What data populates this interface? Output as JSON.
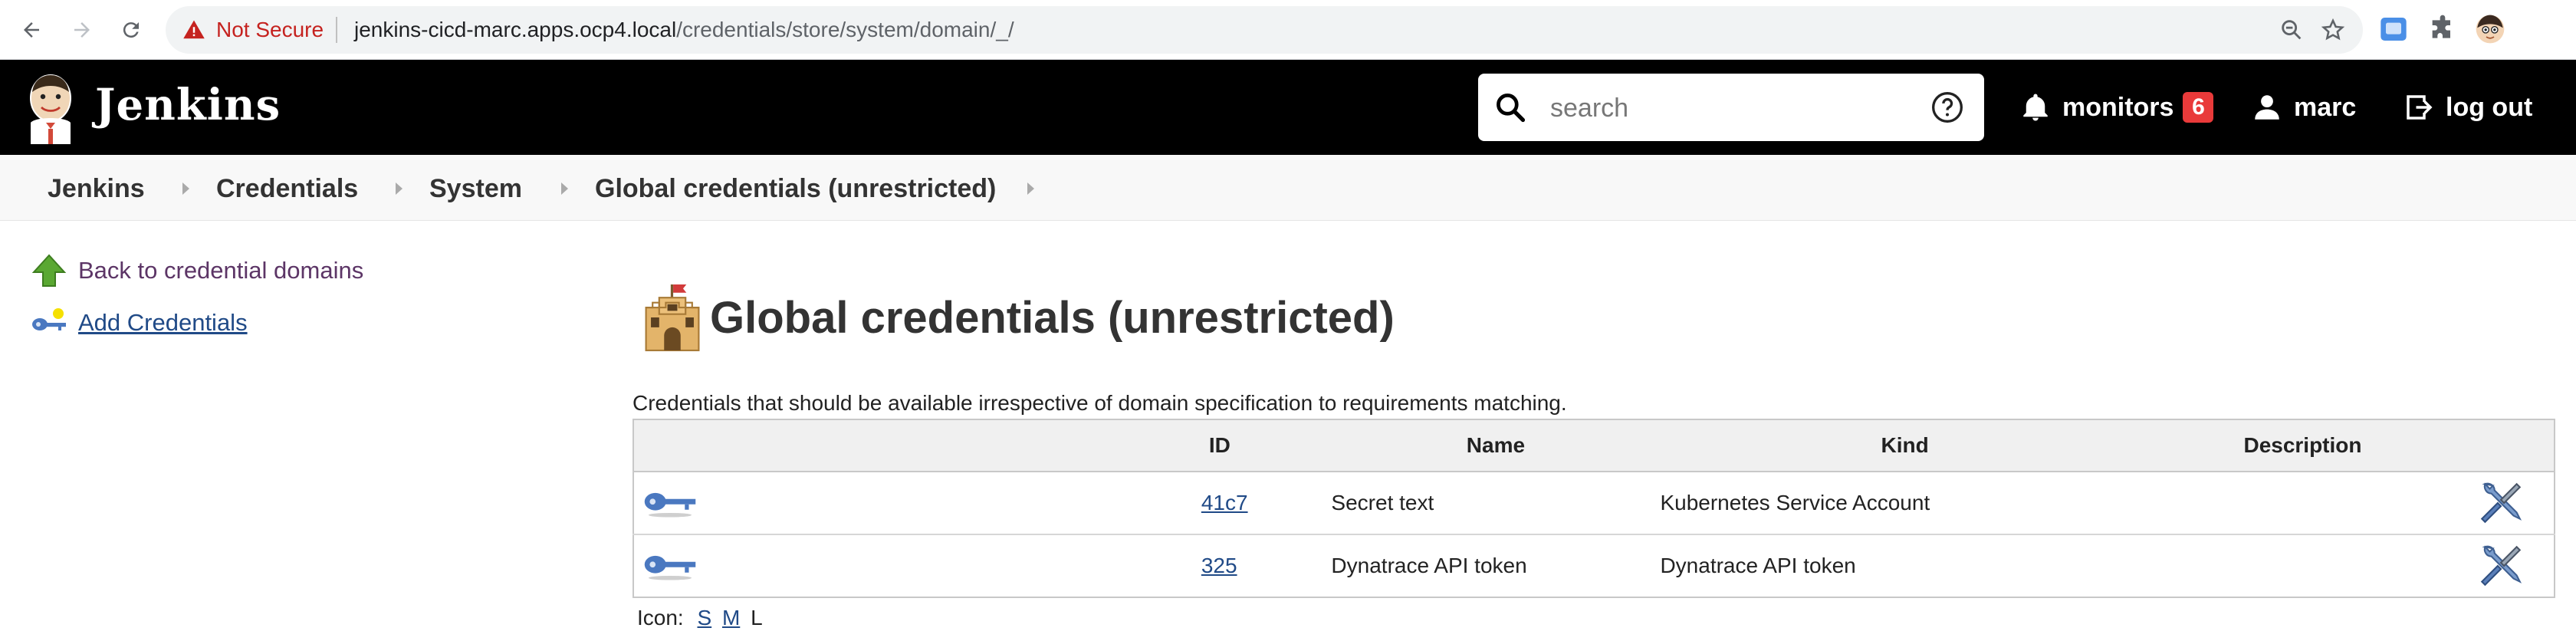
{
  "browser": {
    "security_label": "Not Secure",
    "url_host": "jenkins-cicd-marc.apps.ocp4.local",
    "url_path": "/credentials/store/system/domain/_/"
  },
  "header": {
    "brand": "Jenkins",
    "search_placeholder": "search",
    "monitors_label": "monitors",
    "monitors_count": "6",
    "user_label": "marc",
    "logout_label": "log out"
  },
  "breadcrumb": {
    "items": [
      "Jenkins",
      "Credentials",
      "System",
      "Global credentials (unrestricted)"
    ]
  },
  "sidebar": {
    "items": [
      {
        "label": "Back to credential domains",
        "icon": "up-arrow-icon"
      },
      {
        "label": "Add Credentials",
        "icon": "key-icon"
      }
    ]
  },
  "main": {
    "title": "Global credentials (unrestricted)",
    "description": "Credentials that should be available irrespective of domain specification to requirements matching.",
    "table": {
      "headers": {
        "id": "ID",
        "name": "Name",
        "kind": "Kind",
        "description": "Description"
      },
      "rows": [
        {
          "id": "41c7",
          "name": "Secret text",
          "kind": "Kubernetes Service Account",
          "description": ""
        },
        {
          "id": "325",
          "name": "Dynatrace API token",
          "kind": "Dynatrace API token",
          "description": ""
        }
      ]
    },
    "icon_size": {
      "label": "Icon:",
      "s": "S",
      "m": "M",
      "l": "L"
    }
  },
  "colors": {
    "header_bg": "#000000",
    "badge": "#e93a3a",
    "link": "#204a87",
    "visited_link": "#5c3566"
  }
}
